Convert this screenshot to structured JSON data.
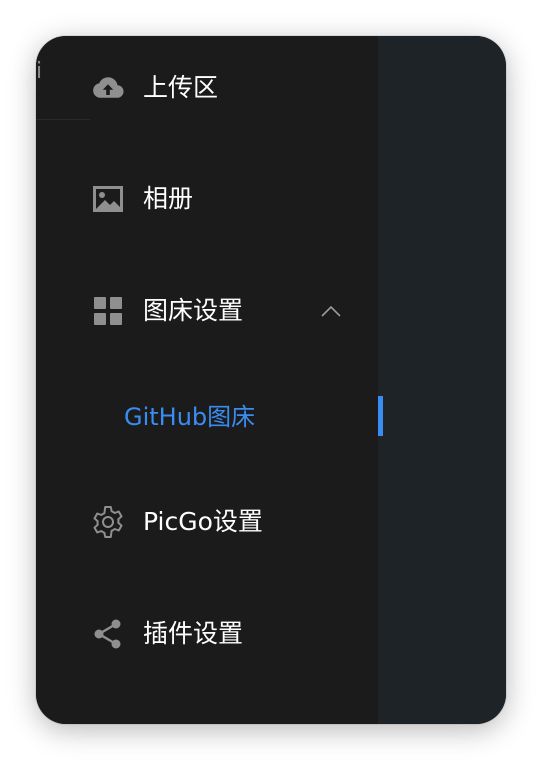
{
  "window": {
    "title_fragment": "i"
  },
  "sidebar": {
    "items": [
      {
        "label": "上传区",
        "icon": "upload-cloud-icon"
      },
      {
        "label": "相册",
        "icon": "gallery-image-icon"
      },
      {
        "label": "图床设置",
        "icon": "grid-icon",
        "expanded": true,
        "chevron": "chevron-up-icon",
        "children": [
          {
            "label": "GitHub图床",
            "active": true
          }
        ]
      },
      {
        "label": "PicGo设置",
        "icon": "gear-icon"
      },
      {
        "label": "插件设置",
        "icon": "share-icon"
      }
    ]
  },
  "colors": {
    "sidebar_bg": "#1b1b1b",
    "content_bg": "#1d2326",
    "text": "#ffffff",
    "icon": "#8f8f8f",
    "accent": "#3a8cf0"
  }
}
